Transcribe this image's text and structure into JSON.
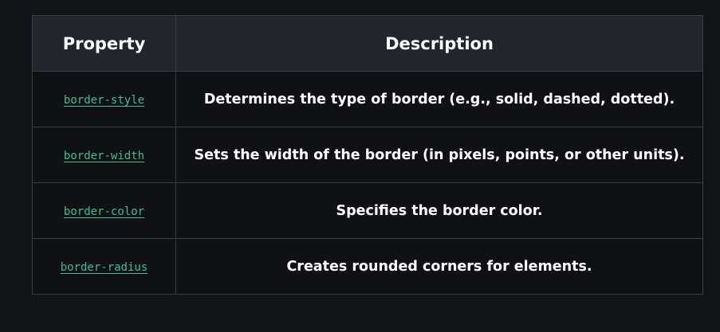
{
  "table": {
    "headers": [
      "Property",
      "Description"
    ],
    "rows": [
      {
        "property": "border-style",
        "description": "Determines the type of border (e.g., solid, dashed, dotted)."
      },
      {
        "property": "border-width",
        "description": "Sets the width of the border (in pixels, points, or other units)."
      },
      {
        "property": "border-color",
        "description": "Specifies the border color."
      },
      {
        "property": "border-radius",
        "description": "Creates rounded corners for elements."
      }
    ]
  },
  "colors": {
    "background": "#131417",
    "header_bg": "#23252d",
    "cell_bg": "#101114",
    "border": "#3a3c44",
    "link": "#3fbf8c",
    "text": "#ffffff"
  }
}
